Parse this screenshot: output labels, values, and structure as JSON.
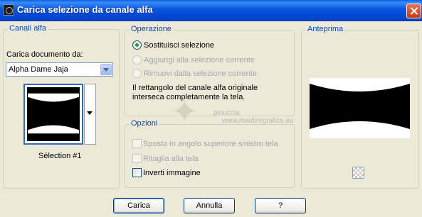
{
  "window": {
    "title": "Carica selezione da canale alfa"
  },
  "canali_alfa": {
    "legend": "Canali alfa",
    "load_label": "Carica documento da:",
    "document_value": "Alpha Dame Jaja",
    "selection_name": "Sélection #1"
  },
  "operazione": {
    "legend": "Operazione",
    "options": [
      {
        "label": "Sostituisci selezione",
        "checked": true,
        "enabled": true
      },
      {
        "label": "Aggiungi alla selezione corrente",
        "checked": false,
        "enabled": false
      },
      {
        "label": "Rimuovi dalla selezione corrente",
        "checked": false,
        "enabled": false
      }
    ],
    "info_line1": "Il rettangolo del canale alfa originale",
    "info_line2": "interseca completamente la tela."
  },
  "opzioni": {
    "legend": "Opzioni",
    "items": [
      {
        "label": "Sposta in angolo superiore sinistro tela",
        "checked": false,
        "enabled": false
      },
      {
        "label": "Ritaglia alla tela",
        "checked": false,
        "enabled": false
      },
      {
        "label": "Inverti immagine",
        "checked": false,
        "enabled": true
      }
    ]
  },
  "anteprima": {
    "legend": "Anteprima"
  },
  "buttons": {
    "ok": "Carica",
    "cancel": "Annulla",
    "help": "?"
  },
  "watermark": {
    "line1": "pinuccia",
    "line2": "www.maidiregrafica.eu"
  },
  "colors": {
    "title_bar": "#0855dd",
    "group_legend": "#0046d5",
    "dialog_bg": "#ece9d8",
    "radio_dot": "#21a121"
  },
  "icons": [
    "app-icon",
    "close-icon",
    "chevron-down-icon",
    "dropdown-arrow-icon",
    "transparency-checker-icon"
  ]
}
